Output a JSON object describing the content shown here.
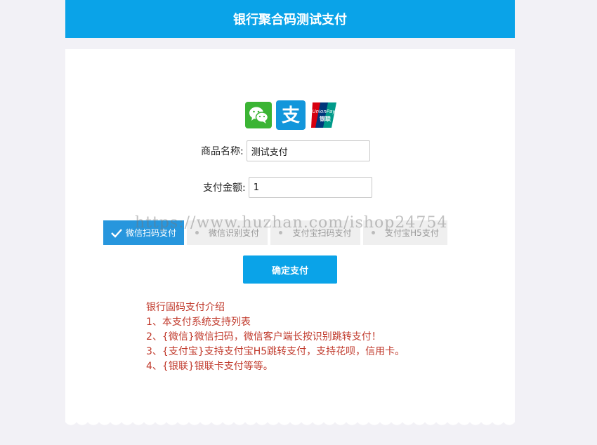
{
  "header": {
    "title": "银行聚合码测试支付"
  },
  "form": {
    "product_label": "商品名称:",
    "product_value": "测试支付",
    "amount_label": "支付金额:",
    "amount_value": "1"
  },
  "payment_icons": [
    "wechat-icon",
    "alipay-icon",
    "unionpay-icon"
  ],
  "unionpay_text": {
    "line1": "UnionPay",
    "line2": "银联"
  },
  "tabs": [
    {
      "label": "微信扫码支付",
      "active": true
    },
    {
      "label": "微信识别支付",
      "active": false
    },
    {
      "label": "支付宝扫码支付",
      "active": false
    },
    {
      "label": "支付宝H5支付",
      "active": false
    }
  ],
  "confirm_label": "确定支付",
  "intro": {
    "title": "银行固码支付介绍",
    "lines": [
      "1、本支付系统支持列表",
      "2、{微信}微信扫码，微信客户端长按识别跳转支付！",
      "3、{支付宝}支持支付宝H5跳转支付，支持花呗，信用卡。",
      "4、{银联}银联卡支付等等。"
    ]
  },
  "watermark": "https://www.huzhan.com/ishop24754",
  "colors": {
    "accent": "#0aa3e8",
    "tab_active": "#2796dd",
    "intro_text": "#c0392b",
    "wechat": "#3bb434",
    "alipay": "#1296db"
  }
}
